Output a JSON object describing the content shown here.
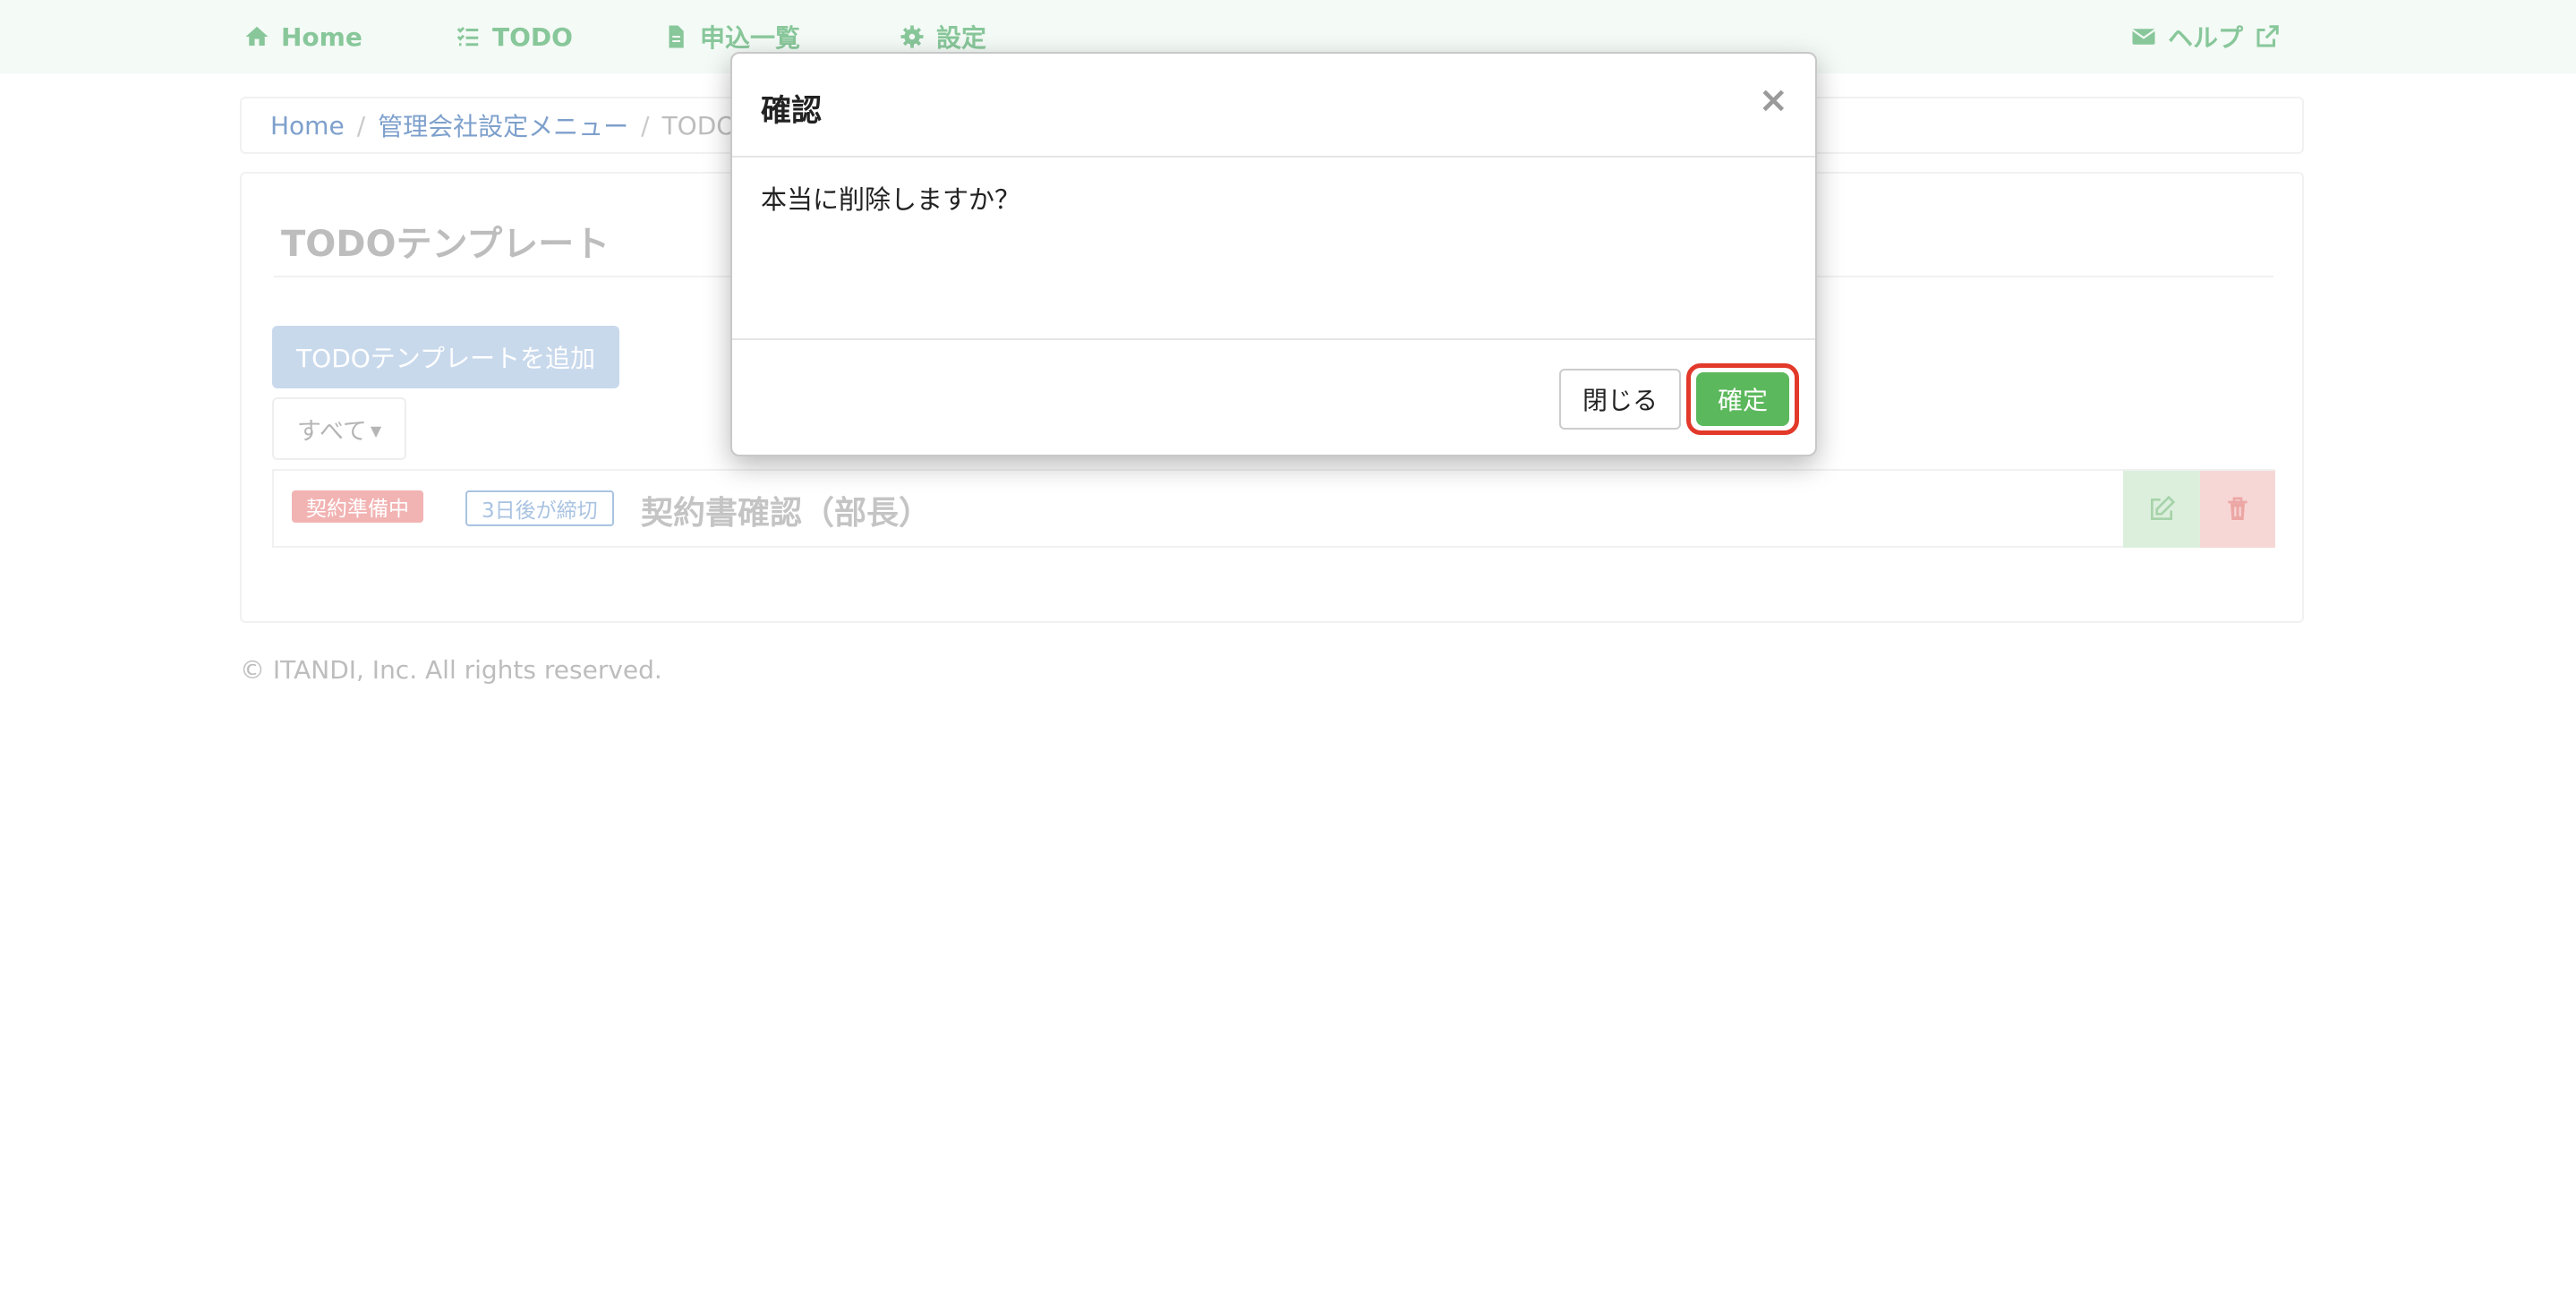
{
  "navbar": {
    "home_label": "Home",
    "todo_label": "TODO",
    "applications_label": "申込一覧",
    "settings_label": "設定",
    "help_label": "ヘルプ"
  },
  "breadcrumb": {
    "home": "Home",
    "settings_menu": "管理会社設定メニュー",
    "current": "TODO"
  },
  "panel": {
    "title": "TODOテンプレート",
    "add_button_label": "TODOテンプレートを追加",
    "filter_label": "すべて"
  },
  "todo_item": {
    "status_badge": "契約準備中",
    "deadline_badge": "3日後が締切",
    "title": "契約書確認（部長）"
  },
  "footer": {
    "copyright": "© ITANDI, Inc. All rights reserved."
  },
  "modal": {
    "title": "確認",
    "close_x": "×",
    "message": "本当に削除しますか？",
    "close_button_label": "閉じる",
    "confirm_button_label": "確定"
  },
  "colors": {
    "navbar_text": "#88c79a",
    "link": "#7ea0cc",
    "confirm_green": "#5cb85c",
    "highlight_red": "#e2392a"
  }
}
